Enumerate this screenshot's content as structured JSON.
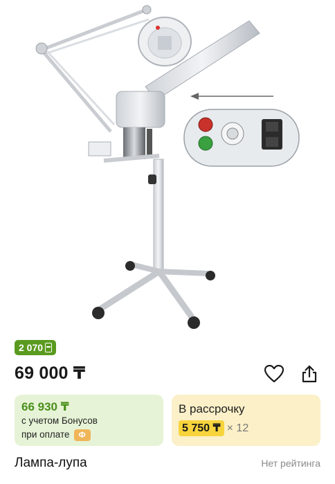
{
  "product": {
    "image_alt": "Лампа-лупа",
    "bonus_badge": "2 070",
    "price": "69 000 ₸",
    "title": "Лампа-лупа",
    "rating_text": "Нет рейтинга"
  },
  "bonus_card": {
    "price": "66 930 ₸",
    "line1": "с учетом Бонусов",
    "line2": "при оплате",
    "pay_icon": "Ф"
  },
  "installment_card": {
    "title": "В рассрочку",
    "amount": "5 750 ₸",
    "multiplier": "× 12"
  },
  "icons": {
    "favorite": "heart-icon",
    "share": "share-icon",
    "bonus": "bonus-icon"
  },
  "colors": {
    "bonus_green": "#5a9a1f",
    "bonus_card_bg": "#e6f3d6",
    "installment_bg": "#fbf0c8",
    "installment_highlight": "#f7d43c",
    "pay_badge": "#f1b559"
  }
}
